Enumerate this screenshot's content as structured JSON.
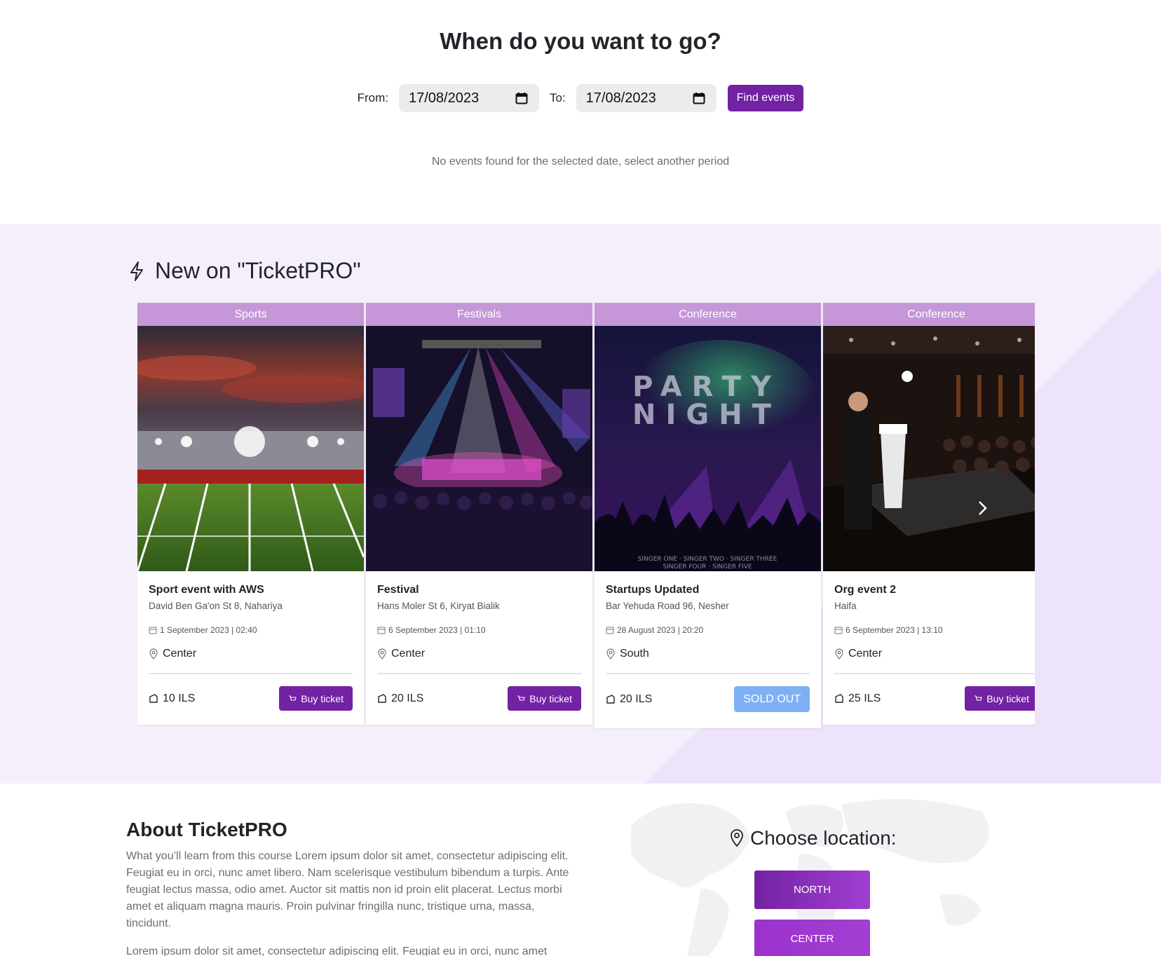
{
  "search": {
    "title": "When do you want to go?",
    "from_label": "From:",
    "from_value": "17/08/2023",
    "to_label": "To:",
    "to_value": "17/08/2023",
    "find_button": "Find events",
    "empty_message": "No events found for the selected date, select another period"
  },
  "new_section": {
    "title": "New on \"TicketPRO\"",
    "icon": "lightning-icon",
    "next_icon": "chevron-right-icon"
  },
  "events": [
    {
      "category": "Sports",
      "name": "Sport event with AWS",
      "address": "David Ben Ga'on St 8, Nahariya",
      "date": "1 September 2023 | 02:40",
      "region": "Center",
      "price": "10 ILS",
      "action": "Buy ticket",
      "sold_out": false
    },
    {
      "category": "Festivals",
      "name": "Festival",
      "address": "Hans Moler St 6, Kiryat Bialik",
      "date": "6 September 2023 | 01:10",
      "region": "Center",
      "price": "20 ILS",
      "action": "Buy ticket",
      "sold_out": false
    },
    {
      "category": "Conference",
      "name": "Startups Updated",
      "address": "Bar Yehuda Road 96, Nesher",
      "date": "28 August 2023 | 20:20",
      "region": "South",
      "price": "20 ILS",
      "action": "SOLD OUT",
      "sold_out": true,
      "poster_title_1": "PARTY",
      "poster_title_2": "NIGHT",
      "poster_footer_1": "SINGER ONE · SINGER TWO · SINGER THREE",
      "poster_footer_2": "SINGER FOUR · SINGER FIVE"
    },
    {
      "category": "Conference",
      "name": "Org event 2",
      "address": "Haifa",
      "date": "6 September 2023 | 13:10",
      "region": "Center",
      "price": "25 ILS",
      "action": "Buy ticket",
      "sold_out": false
    }
  ],
  "about": {
    "title": "About TicketPRO",
    "paragraph1": "What you’ll learn from this course Lorem ipsum dolor sit amet, consectetur adipiscing elit. Feugiat eu in orci, nunc amet libero. Nam scelerisque vestibulum bibendum a turpis. Ante feugiat lectus massa, odio amet. Auctor sit mattis non id proin elit placerat. Lectus morbi amet et aliquam magna mauris. Proin pulvinar fringilla nunc, tristique urna, massa, tincidunt.",
    "paragraph2": "Lorem ipsum dolor sit amet, consectetur adipiscing elit. Feugiat eu in orci, nunc amet"
  },
  "location": {
    "title": "Choose location:",
    "buttons": [
      "NORTH",
      "CENTER"
    ]
  },
  "colors": {
    "brand_purple": "#7322a3",
    "category_header": "#c597d8",
    "sold_out": "#7fb0f5",
    "section_bg": "#f5effc"
  }
}
